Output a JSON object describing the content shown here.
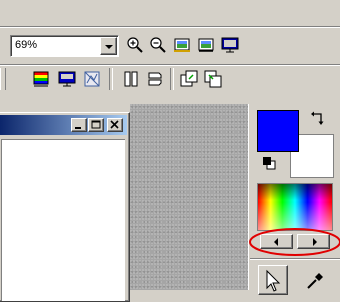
{
  "toolbar": {
    "zoom": {
      "value": "69%"
    },
    "buttons_row1": [
      {
        "name": "zoom-in-icon"
      },
      {
        "name": "zoom-out-icon"
      },
      {
        "name": "fit-image-icon"
      },
      {
        "name": "fit-window-icon"
      },
      {
        "name": "full-screen-icon"
      }
    ],
    "buttons_row2": [
      {
        "name": "color-adjust-icon"
      },
      {
        "name": "screen-icon"
      },
      {
        "name": "crop-icon"
      },
      {
        "name": "flip-horizontal-icon"
      },
      {
        "name": "flip-vertical-icon"
      },
      {
        "name": "rotate-left-icon"
      },
      {
        "name": "rotate-right-icon"
      }
    ]
  },
  "document_window": {
    "buttons": [
      "minimize",
      "maximize",
      "close"
    ]
  },
  "color_panel": {
    "foreground": "#0000ff",
    "background": "#ffffff"
  },
  "highlight_color": "#e00000"
}
